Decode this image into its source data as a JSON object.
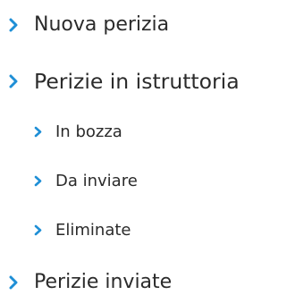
{
  "nav": {
    "accent_color": "#1f8fd6",
    "chevron_icon": "chevron-right-icon",
    "items": [
      {
        "label": "Nuova perizia"
      },
      {
        "label": "Perizie in istruttoria"
      },
      {
        "label": "Perizie inviate"
      }
    ],
    "subitems": [
      {
        "label": "In bozza"
      },
      {
        "label": "Da inviare"
      },
      {
        "label": "Eliminate"
      }
    ]
  }
}
